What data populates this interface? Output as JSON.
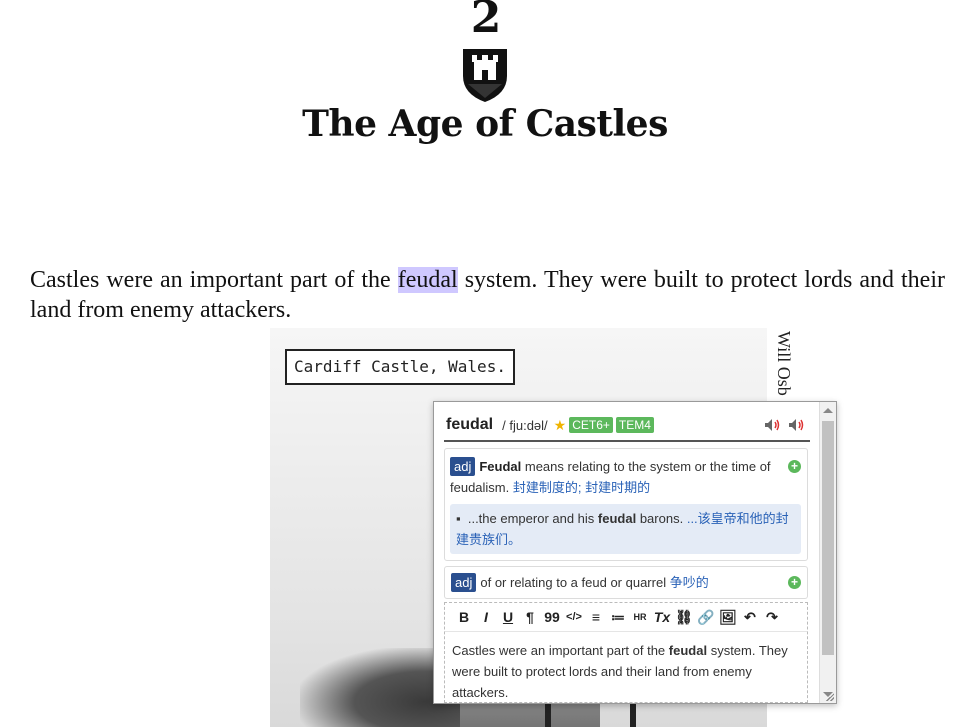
{
  "chapter": {
    "number": "2",
    "title": "The Age of Castles"
  },
  "paragraph": {
    "before": "Castles were an important part of the ",
    "highlight": "feudal",
    "after": " system. They were built to protect lords and their land from enemy attackers."
  },
  "photo": {
    "caption": "Cardiff Castle, Wales.",
    "credit": "Will Osb"
  },
  "popup": {
    "headword": "feudal",
    "phonetic": "/ fju:dəl/",
    "star": "★",
    "tags": [
      "CET6+",
      "TEM4"
    ],
    "senses": [
      {
        "pos": "adj",
        "definition_bold": "Feudal",
        "definition_rest": " means relating to the system or the time of feudalism.",
        "chinese": "封建制度的; 封建时期的",
        "example": {
          "bullet": "▪",
          "before": "...the emperor and his ",
          "bold": "feudal",
          "after": " barons.",
          "chinese": "...该皇帝和他的封建贵族们。"
        }
      },
      {
        "pos": "adj",
        "definition_rest": "of or relating to a feud or quarrel",
        "chinese": "争吵的"
      }
    ],
    "toolbar": [
      "B",
      "I",
      "U",
      "¶",
      "99",
      "</>",
      "≡",
      "≔",
      "HR",
      "Tx",
      "⛓",
      "🔗",
      "🖼",
      "↶",
      "↷"
    ],
    "editor_text": {
      "before": "Castles were an important part of the ",
      "bold": "feudal",
      "after": " system. They were built to protect lords and their land from enemy attackers."
    }
  }
}
